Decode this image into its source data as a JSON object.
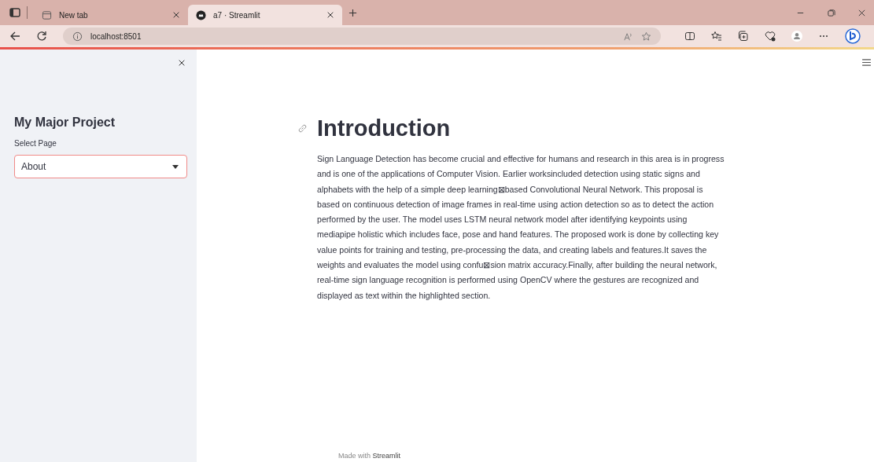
{
  "browser": {
    "tabs": [
      {
        "title": "New tab",
        "selected": false
      },
      {
        "title": "a7 · Streamlit",
        "selected": true
      }
    ],
    "address": "localhost:8501"
  },
  "sidebar": {
    "title": "My Major Project",
    "select": {
      "label": "Select Page",
      "value": "About"
    }
  },
  "main": {
    "heading": "Introduction",
    "paragraph": "Sign Language Detection has become crucial and effective for humans and research in this area is in progress and is one of the applications of Computer Vision. Earlier worksincluded detection using static signs and alphabets with the help of a simple deep learning⊠based Convolutional Neural Network. This proposal is based on continuous detection of image frames in real-time using action detection so as to detect the action performed by the user. The model uses LSTM neural network model after identifying keypoints using mediapipe holistic which includes face, pose and hand features. The proposed work is done by collecting key value points for training and testing, pre-processing the data, and creating labels and features.It saves the weights and evaluates the model using confu⊠sion matrix accuracy.Finally, after building the neural network, real-time sign language recognition is performed using OpenCV where the gestures are recognized and displayed as text within the highlighted section."
  },
  "footer": {
    "prefix": "Made with",
    "brand": "Streamlit"
  }
}
